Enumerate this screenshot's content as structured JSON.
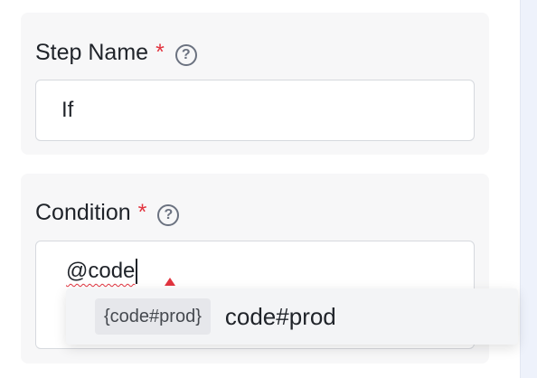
{
  "step_name": {
    "label": "Step Name",
    "required_mark": "*",
    "help_icon": "?",
    "value": "If"
  },
  "condition": {
    "label": "Condition",
    "required_mark": "*",
    "help_icon": "?",
    "value": "@code"
  },
  "autocomplete": {
    "items": [
      {
        "tag": "{code#prod}",
        "label": "code#prod"
      }
    ]
  }
}
